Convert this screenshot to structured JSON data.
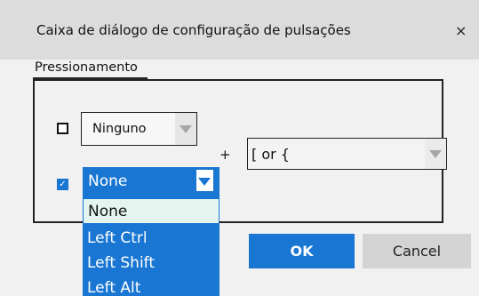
{
  "dialog": {
    "title": "Caixa de diálogo de configuração de pulsações",
    "close_glyph": "×"
  },
  "group": {
    "legend": "Pressionamento"
  },
  "row1": {
    "checkbox_checked": false,
    "combo_value": "Ninguno"
  },
  "plus": "+",
  "key_combo": {
    "value": "[ or {"
  },
  "row2": {
    "checkbox_checked": true,
    "check_glyph": "✓",
    "combo_value": "None"
  },
  "dropdown": {
    "items": [
      {
        "label": "None",
        "selected": true
      },
      {
        "label": "Left Ctrl",
        "selected": false
      },
      {
        "label": "Left Shift",
        "selected": false
      },
      {
        "label": "Left Alt",
        "selected": false
      }
    ]
  },
  "buttons": {
    "ok": "OK",
    "cancel": "Cancel"
  },
  "colors": {
    "accent": "#1976d2",
    "titlebar": "#dcdcdc",
    "background": "#f1f1f1",
    "selected_item_bg": "#e4f5ef"
  }
}
